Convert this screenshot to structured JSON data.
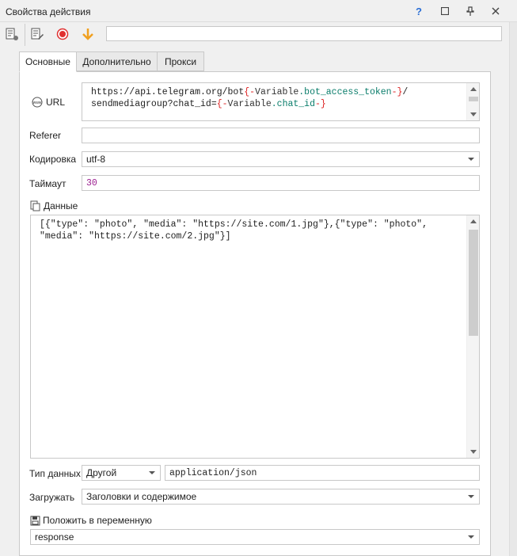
{
  "window": {
    "title": "Свойства действия",
    "help_label": "?",
    "minimize_label": "□",
    "pin_label": "⊥",
    "close_label": "✕"
  },
  "toolbar": {
    "name_value": "",
    "icons": [
      "properties-icon",
      "edit-icon",
      "record-icon",
      "arrow-down-icon"
    ],
    "accent_record": "#e03030",
    "accent_arrow": "#f0a020"
  },
  "tabs": [
    {
      "label": "Основные",
      "active": true
    },
    {
      "label": "Дополнительно",
      "active": false
    },
    {
      "label": "Прокси",
      "active": false
    }
  ],
  "url": {
    "label": "URL",
    "line1_prefix": "https://api.telegram.org/bot",
    "line1_brace_open": "{-",
    "line1_var_kw": "Variable",
    "line1_var_name": ".bot_access_token",
    "line1_brace_close": "-}",
    "line1_suffix": "/",
    "line2_prefix": "sendmediagroup?chat_id=",
    "line2_brace_open": "{-",
    "line2_var_kw": "Variable",
    "line2_var_name": ".chat_id",
    "line2_brace_close": "-}"
  },
  "referer": {
    "label": "Referer",
    "value": ""
  },
  "encoding": {
    "label": "Кодировка",
    "value": "utf-8"
  },
  "timeout": {
    "label": "Таймаут",
    "value": "30"
  },
  "data": {
    "label": "Данные",
    "line1": "[{\"type\": \"photo\", \"media\": \"https://site.com/1.jpg\"},{\"type\": \"photo\",",
    "line2": "\"media\": \"https://site.com/2.jpg\"}]"
  },
  "data_type": {
    "label": "Тип данных",
    "value": "Другой",
    "content_type": "application/json"
  },
  "load": {
    "label": "Загружать",
    "value": "Заголовки и содержимое"
  },
  "save_to_var": {
    "label": "Положить в переменную",
    "value": "response"
  }
}
